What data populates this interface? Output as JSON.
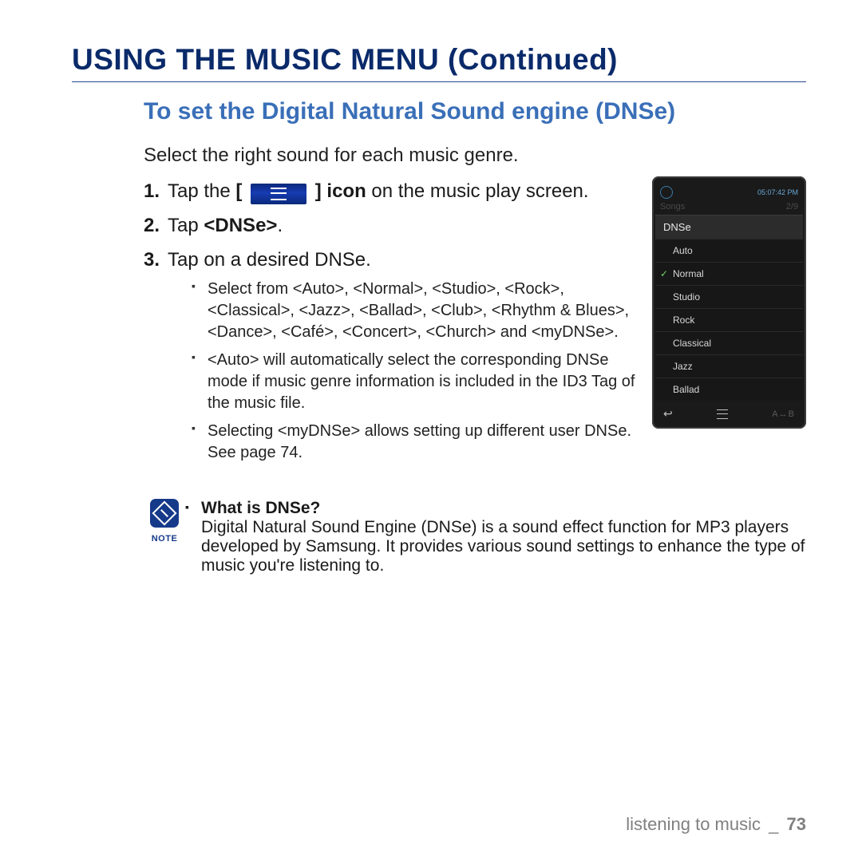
{
  "heading": "USING THE MUSIC MENU (Continued)",
  "subheading": "To set the Digital Natural Sound engine (DNSe)",
  "intro": "Select the right sound for each music genre.",
  "steps": {
    "s1_pre": "Tap the ",
    "s1_open": "[",
    "s1_close": "]",
    "s1_icon_word": " icon",
    "s1_post": " on the music play screen.",
    "s2_pre": "Tap ",
    "s2_bold": "<DNSe>",
    "s2_post": ".",
    "s3": "Tap on a desired DNSe."
  },
  "bullets": {
    "b1": "Select from <Auto>, <Normal>, <Studio>, <Rock>, <Classical>, <Jazz>, <Ballad>, <Club>, <Rhythm & Blues>, <Dance>, <Café>, <Concert>, <Church> and <myDNSe>.",
    "b2": "<Auto> will automatically select the corresponding DNSe mode if music genre information is included in the ID3 Tag of the music file.",
    "b3": "Selecting <myDNSe> allows setting up different user DNSe. See page 74."
  },
  "device": {
    "time": "05:07:42 PM",
    "title_left": "Songs",
    "title_right": "2/9",
    "panel_title": "DNSe",
    "options": [
      "Auto",
      "Normal",
      "Studio",
      "Rock",
      "Classical",
      "Jazz",
      "Ballad"
    ],
    "selected_index": 1,
    "ab_label": "A↔B"
  },
  "note": {
    "label": "NOTE",
    "question": "What is DNSe?",
    "answer": "Digital Natural Sound Engine (DNSe) is a sound effect function for MP3 players developed by Samsung. It provides various sound settings to enhance the type of music you're listening to."
  },
  "footer": {
    "section": "listening to music",
    "separator": "_",
    "page": "73"
  }
}
